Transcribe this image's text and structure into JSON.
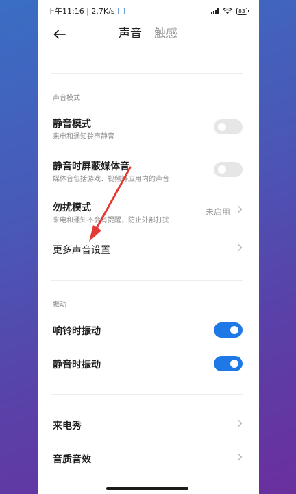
{
  "status_bar": {
    "time_speed": "上午11:16 | 2.7K/s",
    "battery": "83"
  },
  "header": {
    "tab_sound": "声音",
    "tab_haptics": "触感"
  },
  "sections": {
    "sound_mode_title": "声音模式",
    "vibration_title": "振动"
  },
  "rows": {
    "silent_mode": {
      "title": "静音模式",
      "subtitle": "来电和通知铃声静音",
      "toggle": "off"
    },
    "mute_media": {
      "title": "静音时屏蔽媒体音",
      "subtitle": "媒体音包括游戏、视频等应用内的声音",
      "toggle": "off"
    },
    "dnd": {
      "title": "勿扰模式",
      "subtitle": "来电和通知不会有提醒，防止外部打扰",
      "value": "未启用"
    },
    "more_sound": {
      "title": "更多声音设置"
    },
    "vibrate_ring": {
      "title": "响铃时振动",
      "toggle": "on"
    },
    "vibrate_silent": {
      "title": "静音时振动",
      "toggle": "on"
    },
    "caller_show": {
      "title": "来电秀"
    },
    "sound_effects": {
      "title": "音质音效"
    }
  },
  "colors": {
    "accent": "#1e78e6",
    "annotation_arrow": "#e53935"
  },
  "icons": {
    "back": "arrow-left-icon",
    "chevron": "chevron-right-icon"
  }
}
